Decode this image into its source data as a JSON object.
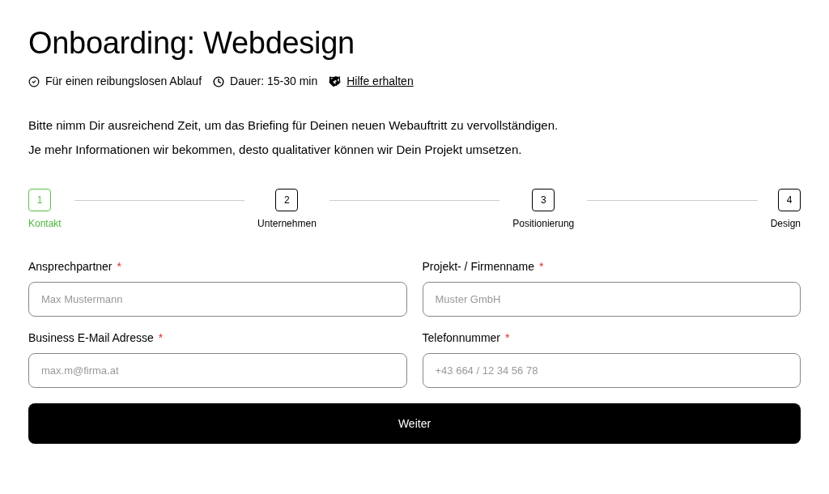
{
  "title": "Onboarding: Webdesign",
  "meta": [
    {
      "kind": "check",
      "text": "Für einen reibungslosen Ablauf"
    },
    {
      "kind": "clock",
      "text": "Dauer: 15-30 min"
    },
    {
      "kind": "link",
      "text": "Hilfe erhalten"
    }
  ],
  "intro": [
    "Bitte nimm Dir ausreichend Zeit, um das Briefing für Deinen neuen Webauftritt zu vervollständigen.",
    "Je mehr Informationen wir bekommen, desto qualitativer können wir Dein Projekt umsetzen."
  ],
  "steps": [
    {
      "number": "1",
      "label": "Kontakt",
      "selected": true
    },
    {
      "number": "2",
      "label": "Unternehmen",
      "selected": false
    },
    {
      "number": "3",
      "label": "Positionierung",
      "selected": false
    },
    {
      "number": "4",
      "label": "Design",
      "selected": false
    }
  ],
  "fields": [
    {
      "label": "Ansprechpartner",
      "required": true,
      "placeholder": "Max Mustermann"
    },
    {
      "label": "Projekt- / Firmenname",
      "required": true,
      "placeholder": "Muster GmbH"
    },
    {
      "label": "Business E-Mail Adresse",
      "required": true,
      "placeholder": "max.m@firma.at"
    },
    {
      "label": "Telefonnummer",
      "required": true,
      "placeholder": "+43 664 / 12 34 56 78"
    }
  ],
  "required_mark": "*",
  "submit": "Weiter"
}
